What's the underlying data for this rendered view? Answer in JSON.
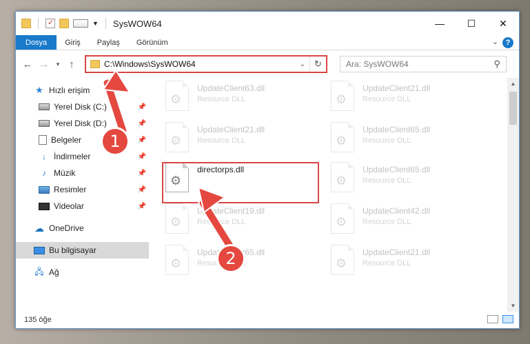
{
  "window": {
    "title": "SysWOW64",
    "caption": {
      "minimize": "—",
      "maximize": "☐",
      "close": "✕"
    }
  },
  "ribbon": {
    "tabs": [
      "Dosya",
      "Giriş",
      "Paylaş",
      "Görünüm"
    ],
    "help": "?"
  },
  "nav": {
    "address": "C:\\Windows\\SysWOW64",
    "search_placeholder": "Ara: SysWOW64"
  },
  "sidebar": {
    "quick_access": "Hızlı erişim",
    "items": [
      {
        "label": "Yerel Disk (C:)",
        "icon": "drive-icon"
      },
      {
        "label": "Yerel Disk (D:)",
        "icon": "drive-icon"
      },
      {
        "label": "Belgeler",
        "icon": "documents-icon"
      },
      {
        "label": "İndirmeler",
        "icon": "download-icon"
      },
      {
        "label": "Müzik",
        "icon": "music-icon"
      },
      {
        "label": "Resimler",
        "icon": "pictures-icon"
      },
      {
        "label": "Videolar",
        "icon": "videos-icon"
      }
    ],
    "onedrive": "OneDrive",
    "this_pc": "Bu bilgisayar",
    "network": "Ağ"
  },
  "files": [
    {
      "name": "UpdateClient63.dll",
      "desc": "Resource DLL"
    },
    {
      "name": "UpdateClient21.dll",
      "desc": "Resource DLL"
    },
    {
      "name": "UpdateClient21.dll",
      "desc": "Resource DLL"
    },
    {
      "name": "UpdateClient65.dll",
      "desc": "Resource DLL"
    },
    {
      "name": "directorps.dll",
      "desc": ""
    },
    {
      "name": "UpdateClient65.dll",
      "desc": "Resource DLL"
    },
    {
      "name": "UpdateClient19.dll",
      "desc": "Resource DLL"
    },
    {
      "name": "UpdateClient42.dll",
      "desc": "Resource DLL"
    },
    {
      "name": "UpdateClient65.dll",
      "desc": "Resource DLL"
    },
    {
      "name": "UpdateClient21.dll",
      "desc": "Resource DLL"
    }
  ],
  "status": {
    "count": "135 öğe"
  },
  "annotations": {
    "step1": "1",
    "step2": "2",
    "color": "#e4483f"
  }
}
